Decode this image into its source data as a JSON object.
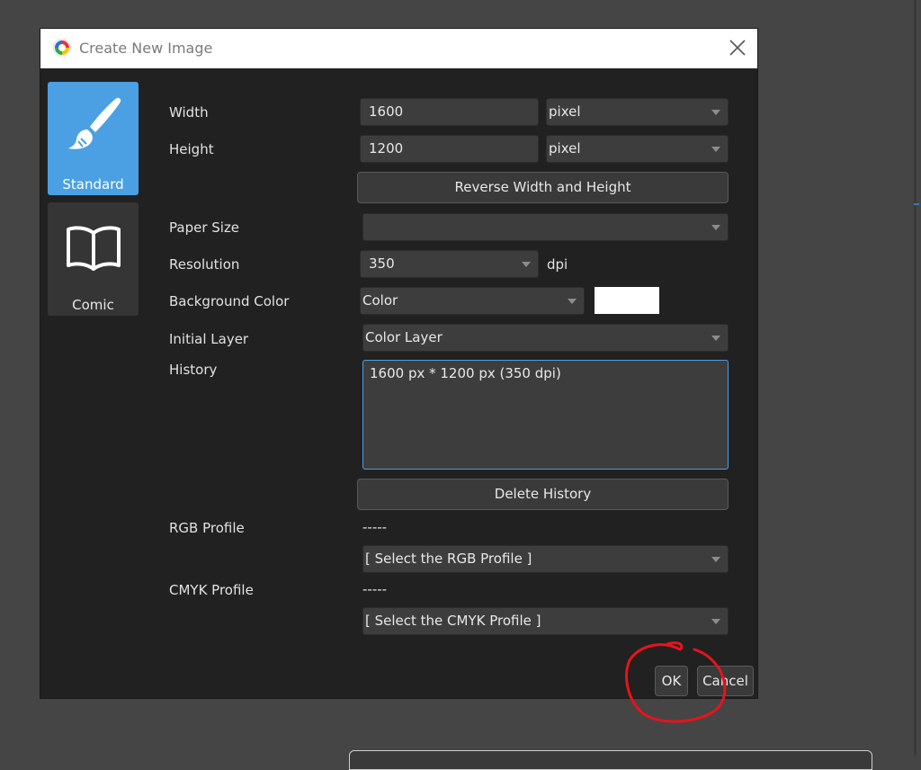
{
  "dialog": {
    "title": "Create New Image"
  },
  "sidebar": {
    "tabs": [
      {
        "label": "Standard",
        "icon": "brush-icon",
        "selected": true
      },
      {
        "label": "Comic",
        "icon": "open-book-icon",
        "selected": false
      }
    ]
  },
  "form": {
    "width": {
      "label": "Width",
      "value": "1600",
      "unit": "pixel"
    },
    "height": {
      "label": "Height",
      "value": "1200",
      "unit": "pixel"
    },
    "reverse_button": "Reverse Width and Height",
    "paper_size": {
      "label": "Paper Size",
      "value": ""
    },
    "resolution": {
      "label": "Resolution",
      "value": "350",
      "unit": "dpi"
    },
    "background": {
      "label": "Background Color",
      "value": "Color",
      "swatch_color": "#ffffff"
    },
    "initial_layer": {
      "label": "Initial Layer",
      "value": "Color Layer"
    },
    "history": {
      "label": "History",
      "items": [
        "1600 px * 1200 px (350 dpi)"
      ]
    },
    "delete_history_button": "Delete History",
    "rgb_profile": {
      "label": "RGB Profile",
      "value": "-----",
      "select": "[ Select the RGB Profile ]"
    },
    "cmyk_profile": {
      "label": "CMYK Profile",
      "value": "-----",
      "select": "[ Select the CMYK Profile ]"
    }
  },
  "footer": {
    "ok": "OK",
    "cancel": "Cancel"
  },
  "colors": {
    "accent": "#4aa0e3",
    "annotation": "#e8131b"
  }
}
